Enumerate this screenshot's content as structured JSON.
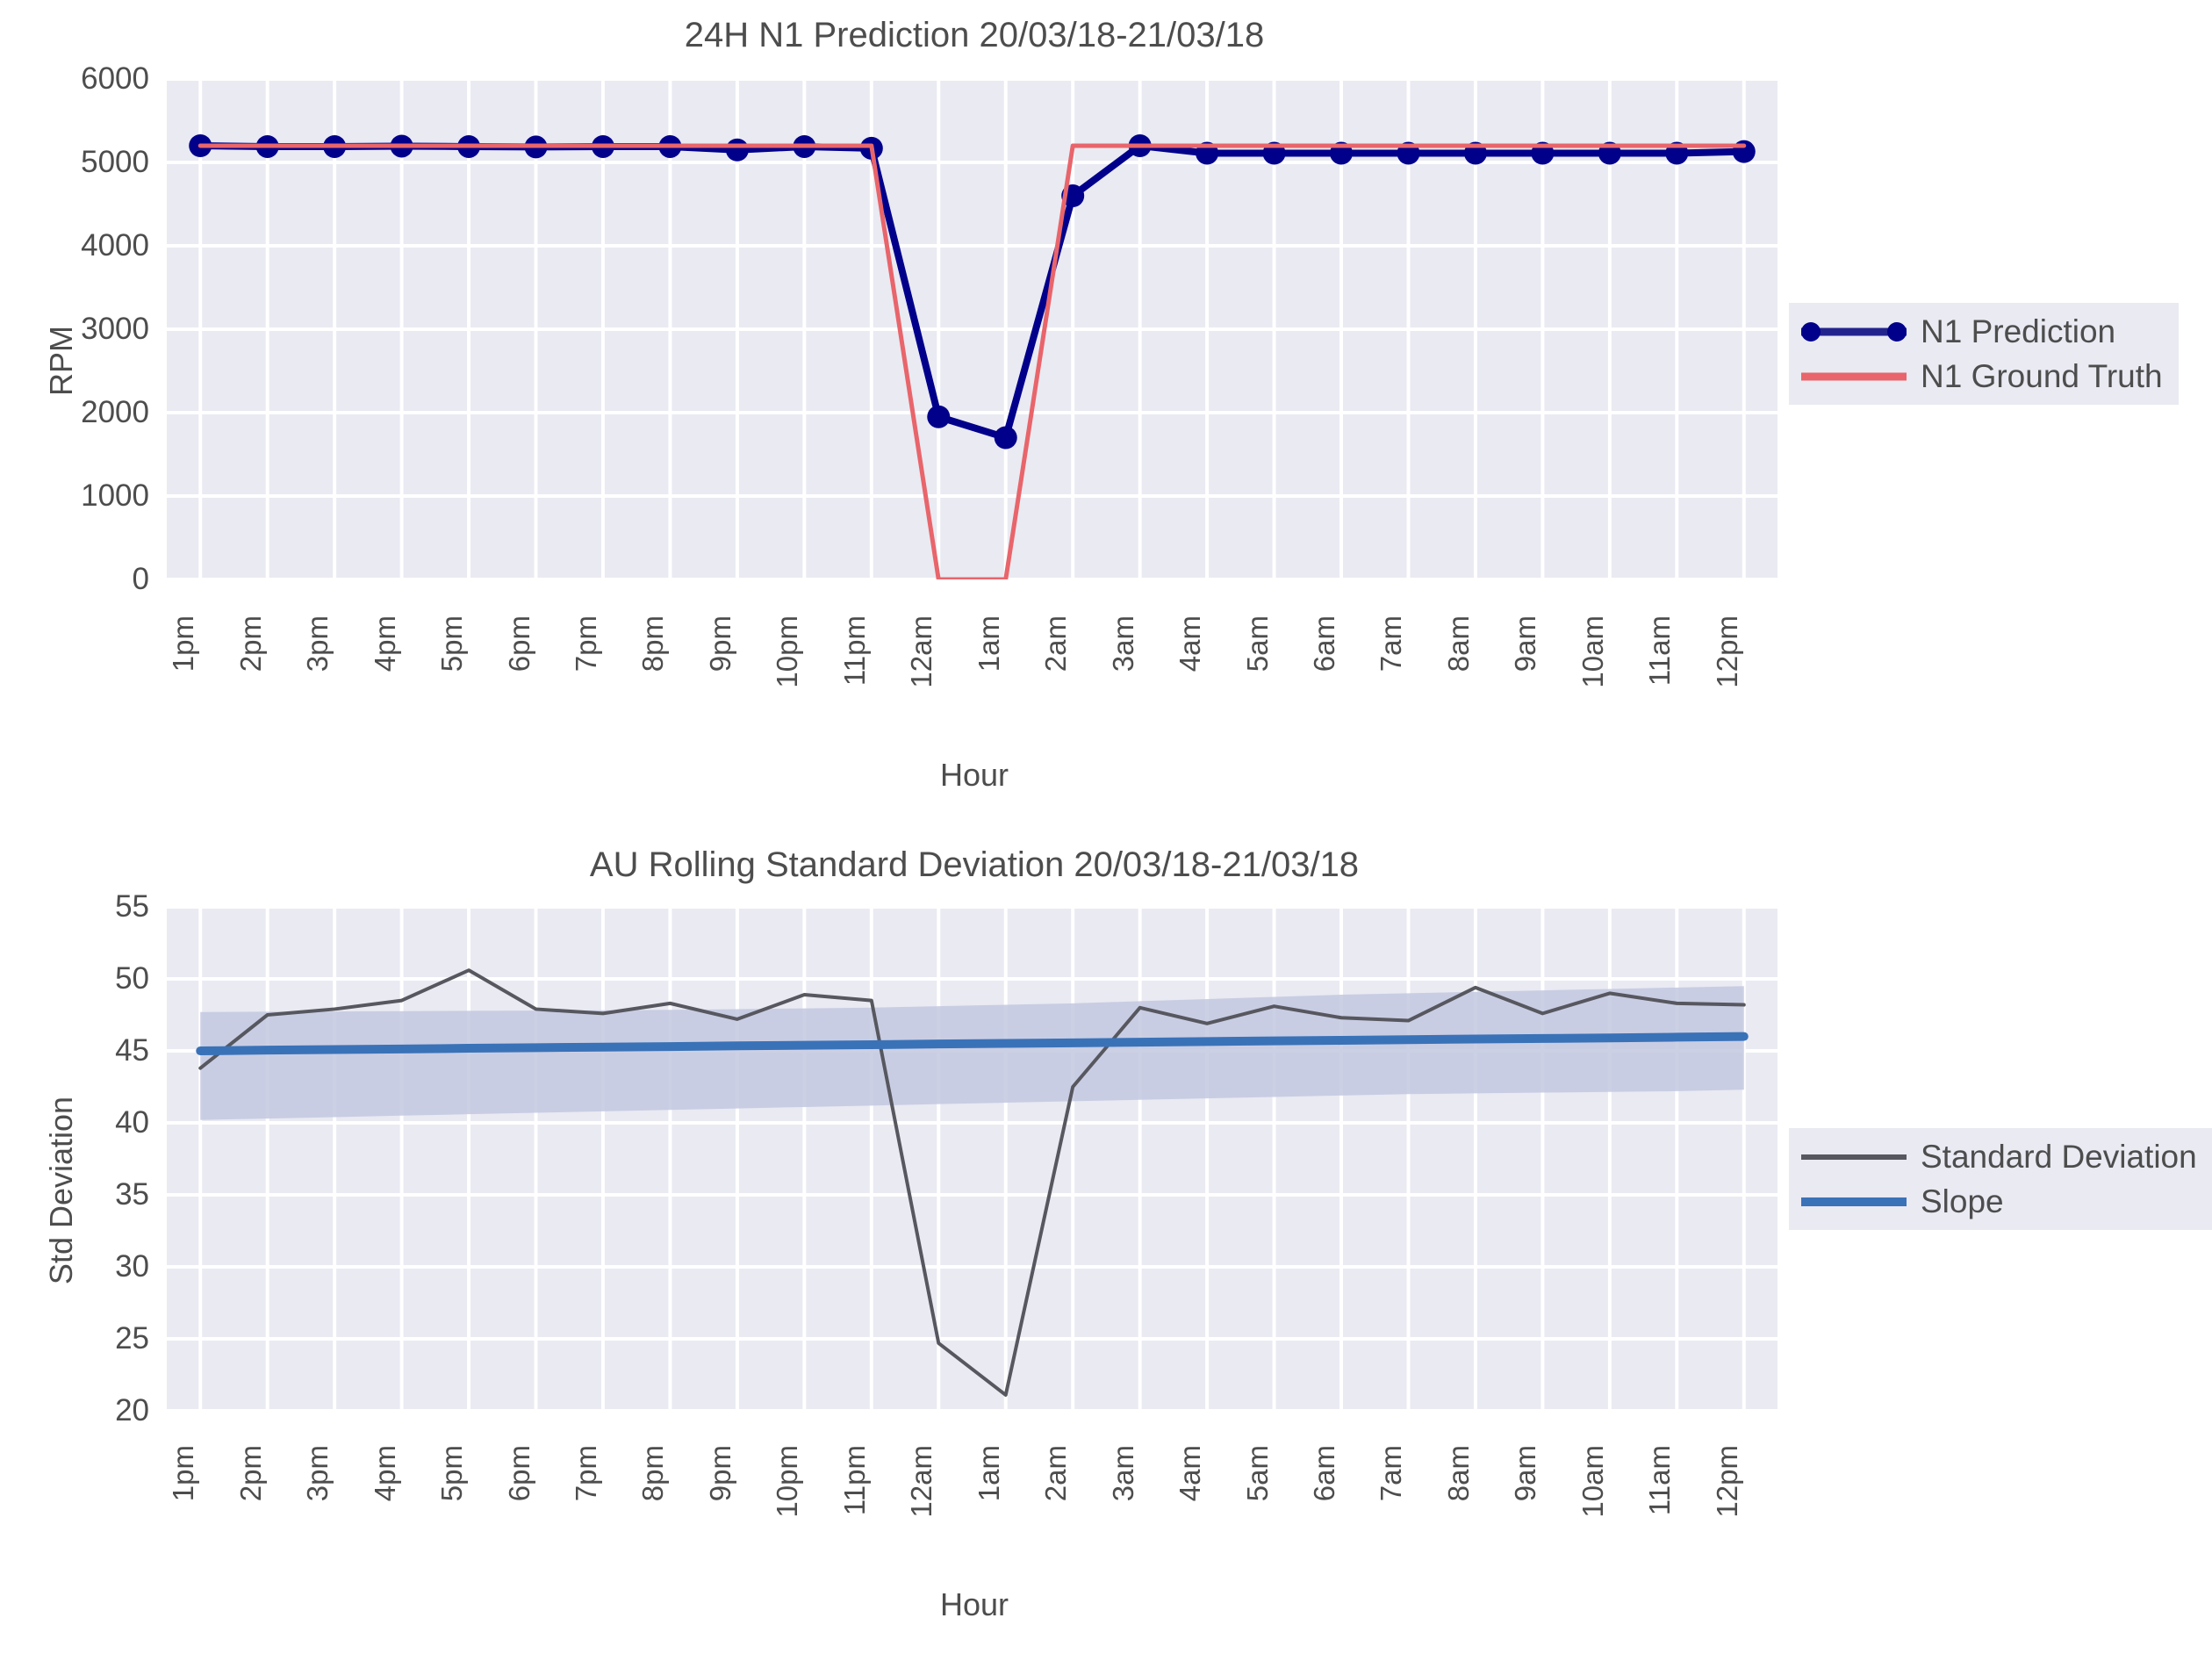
{
  "figure": {
    "background_color": "#ffffff",
    "plot_background_color": "#e9eaf2",
    "grid_color": "#ffffff",
    "text_color": "#4d4d4d"
  },
  "charts": [
    {
      "id": "n1-prediction",
      "title": "24H N1 Prediction 20/03/18-21/03/18",
      "xlabel": "Hour",
      "ylabel": "RPM",
      "yticks": [
        "0",
        "1000",
        "2000",
        "3000",
        "4000",
        "5000",
        "6000"
      ],
      "xticks": [
        "1pm",
        "2pm",
        "3pm",
        "4pm",
        "5pm",
        "6pm",
        "7pm",
        "8pm",
        "9pm",
        "10pm",
        "11pm",
        "12am",
        "1am",
        "2am",
        "3am",
        "4am",
        "5am",
        "6am",
        "7am",
        "8am",
        "9am",
        "10am",
        "11am",
        "12pm"
      ],
      "legend": [
        {
          "label": "N1 Prediction",
          "color": "#00008b",
          "marker": true
        },
        {
          "label": "N1 Ground Truth",
          "color": "#e8656b",
          "marker": false
        }
      ]
    },
    {
      "id": "au-rolling-std",
      "title": "AU Rolling Standard Deviation 20/03/18-21/03/18",
      "xlabel": "Hour",
      "ylabel": "Std Deviation",
      "yticks": [
        "20",
        "25",
        "30",
        "35",
        "40",
        "45",
        "50",
        "55"
      ],
      "xticks": [
        "1pm",
        "2pm",
        "3pm",
        "4pm",
        "5pm",
        "6pm",
        "7pm",
        "8pm",
        "9pm",
        "10pm",
        "11pm",
        "12am",
        "1am",
        "2am",
        "3am",
        "4am",
        "5am",
        "6am",
        "7am",
        "8am",
        "9am",
        "10am",
        "11am",
        "12pm"
      ],
      "legend": [
        {
          "label": "Standard Deviation",
          "color": "#57575f",
          "marker": false
        },
        {
          "label": "Slope",
          "color": "#3a72b8",
          "marker": false
        }
      ]
    }
  ],
  "chart_data": [
    {
      "type": "line",
      "id": "n1-prediction",
      "title": "24H N1 Prediction 20/03/18-21/03/18",
      "xlabel": "Hour",
      "ylabel": "RPM",
      "ylim": [
        0,
        6000
      ],
      "ytick_values": [
        0,
        1000,
        2000,
        3000,
        4000,
        5000,
        6000
      ],
      "grid": true,
      "legend_position": "right",
      "categories": [
        "1pm",
        "2pm",
        "3pm",
        "4pm",
        "5pm",
        "6pm",
        "7pm",
        "8pm",
        "9pm",
        "10pm",
        "11pm",
        "12am",
        "1am",
        "2am",
        "3am",
        "4am",
        "5am",
        "6am",
        "7am",
        "8am",
        "9am",
        "10am",
        "11am",
        "12pm"
      ],
      "series": [
        {
          "name": "N1 Prediction",
          "color": "#00008b",
          "marker": "circle",
          "linestyle": "solid",
          "values": [
            5200,
            5190,
            5190,
            5195,
            5190,
            5185,
            5190,
            5190,
            5150,
            5190,
            5170,
            1950,
            1700,
            4600,
            5200,
            5110,
            5110,
            5110,
            5110,
            5110,
            5110,
            5110,
            5110,
            5130
          ]
        },
        {
          "name": "N1 Ground Truth",
          "color": "#e8656b",
          "marker": "none",
          "linestyle": "solid",
          "values": [
            5200,
            5200,
            5200,
            5200,
            5200,
            5200,
            5200,
            5200,
            5200,
            5200,
            5200,
            0,
            0,
            5200,
            5200,
            5200,
            5200,
            5200,
            5200,
            5200,
            5200,
            5200,
            5200,
            5200
          ]
        }
      ]
    },
    {
      "type": "line",
      "id": "au-rolling-std",
      "title": "AU Rolling Standard Deviation 20/03/18-21/03/18",
      "xlabel": "Hour",
      "ylabel": "Std Deviation",
      "ylim": [
        20,
        55
      ],
      "ytick_values": [
        20,
        25,
        30,
        35,
        40,
        45,
        50,
        55
      ],
      "grid": true,
      "legend_position": "right",
      "categories": [
        "1pm",
        "2pm",
        "3pm",
        "4pm",
        "5pm",
        "6pm",
        "7pm",
        "8pm",
        "9pm",
        "10pm",
        "11pm",
        "12am",
        "1am",
        "2am",
        "3am",
        "4am",
        "5am",
        "6am",
        "7am",
        "8am",
        "9am",
        "10am",
        "11am",
        "12pm"
      ],
      "series": [
        {
          "name": "Standard Deviation",
          "color": "#57575f",
          "marker": "none",
          "linestyle": "solid",
          "values": [
            43.8,
            47.5,
            47.9,
            48.5,
            50.6,
            47.9,
            47.6,
            48.3,
            47.2,
            48.9,
            48.5,
            24.7,
            21.1,
            42.5,
            48.0,
            46.9,
            48.1,
            47.3,
            47.1,
            49.4,
            47.6,
            49.0,
            48.3,
            48.2
          ]
        },
        {
          "name": "Slope",
          "color": "#3a72b8",
          "marker": "none",
          "linestyle": "solid",
          "values": [
            45.0,
            45.05,
            45.09,
            45.13,
            45.18,
            45.22,
            45.26,
            45.3,
            45.35,
            45.39,
            45.43,
            45.48,
            45.52,
            45.56,
            45.6,
            45.65,
            45.69,
            45.73,
            45.78,
            45.82,
            45.86,
            45.9,
            45.95,
            46.0
          ]
        }
      ],
      "confidence_band": {
        "name": "Slope confidence interval",
        "color": "#c3c8e0",
        "upper": [
          47.7,
          47.72,
          47.74,
          47.76,
          47.78,
          47.8,
          47.82,
          47.85,
          47.9,
          47.95,
          48.0,
          48.1,
          48.2,
          48.3,
          48.45,
          48.6,
          48.75,
          48.9,
          49.0,
          49.1,
          49.2,
          49.3,
          49.4,
          49.5
        ],
        "lower": [
          40.2,
          40.3,
          40.4,
          40.5,
          40.6,
          40.7,
          40.8,
          40.9,
          41.0,
          41.1,
          41.2,
          41.3,
          41.4,
          41.5,
          41.6,
          41.7,
          41.8,
          41.9,
          42.0,
          42.05,
          42.1,
          42.15,
          42.2,
          42.3
        ]
      }
    }
  ]
}
